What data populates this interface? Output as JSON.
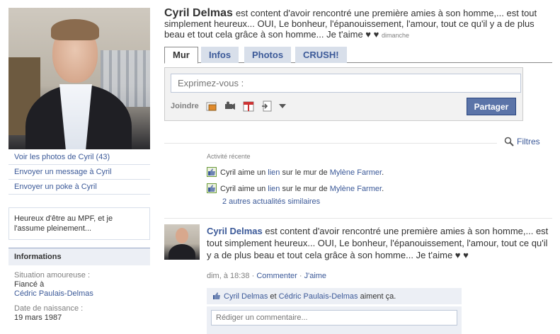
{
  "left": {
    "links": [
      "Voir les photos de Cyril (43)",
      "Envoyer un message à Cyril",
      "Envoyer un poke à Cyril"
    ],
    "bio": "Heureux d'être au MPF, et je l'assume pleinement...",
    "info": {
      "header": "Informations",
      "relationship_label": "Situation amoureuse :",
      "relationship_value": "Fiancé à",
      "relationship_partner": "Cédric Paulais-Delmas",
      "birthday_label": "Date de naissance :",
      "birthday_value": "19 mars 1987"
    }
  },
  "status": {
    "name": "Cyril Delmas",
    "text": "est content d'avoir rencontré une première amies à son homme,... est tout simplement heureux... OUI, Le bonheur, l'épanouissement, l'amour, tout ce qu'il y a de plus beau et tout cela grâce à son homme... Je t'aime ♥ ♥",
    "time": "dimanche"
  },
  "tabs": [
    "Mur",
    "Infos",
    "Photos",
    "CRUSH!"
  ],
  "composer": {
    "placeholder": "Exprimez-vous :",
    "attach_label": "Joindre",
    "share_label": "Partager"
  },
  "filters_label": "Filtres",
  "recent": {
    "title": "Activité récente",
    "rows": [
      {
        "actor": "Cyril aime un",
        "link": "lien",
        "mid": "sur le mur de",
        "target": "Mylène Farmer",
        "end": "."
      },
      {
        "actor": "Cyril aime un",
        "link": "lien",
        "mid": "sur le mur de",
        "target": "Mylène Farmer",
        "end": "."
      }
    ],
    "more": "2 autres actualités similaires"
  },
  "story": {
    "name": "Cyril Delmas",
    "text": "est content d'avoir rencontré une première amies à son homme,... est tout simplement heureux... OUI, Le bonheur, l'épanouissement, l'amour, tout ce qu'il y a de plus beau et tout cela grâce à son homme... Je t'aime ♥ ♥",
    "time": "dim, à 18:38",
    "sep": "·",
    "comment_label": "Commenter",
    "like_label": "J'aime",
    "likes_user1": "Cyril Delmas",
    "likes_and": "et",
    "likes_user2": "Cédric Paulais-Delmas",
    "likes_suffix": "aiment ça.",
    "comment_placeholder": "Rédiger un commentaire..."
  },
  "colors": {
    "link": "#3b5998",
    "tab_bg": "#d8dfea",
    "button": "#5b74a8"
  }
}
